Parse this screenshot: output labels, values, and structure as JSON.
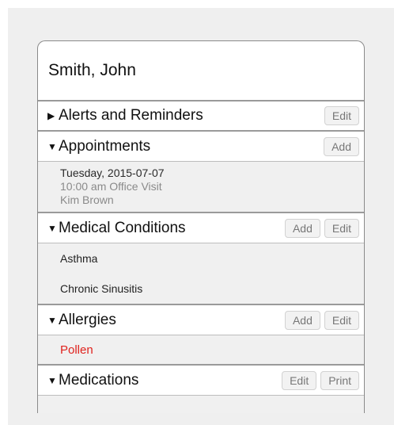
{
  "patient": {
    "name": "Smith, John"
  },
  "sections": {
    "alerts": {
      "arrow": "▶",
      "title": "Alerts and Reminders",
      "buttons": [
        "Edit"
      ]
    },
    "appointments": {
      "arrow": "▼",
      "title": "Appointments",
      "buttons": [
        "Add"
      ],
      "items": [
        {
          "date": "Tuesday, 2015-07-07",
          "time_type": "10:00 am Office Visit",
          "provider": "Kim Brown"
        }
      ]
    },
    "conditions": {
      "arrow": "▼",
      "title": "Medical Conditions",
      "buttons": [
        "Add",
        "Edit"
      ],
      "items": [
        "Asthma",
        "Chronic Sinusitis"
      ]
    },
    "allergies": {
      "arrow": "▼",
      "title": "Allergies",
      "buttons": [
        "Add",
        "Edit"
      ],
      "items": [
        "Pollen"
      ]
    },
    "medications": {
      "arrow": "▼",
      "title": "Medications",
      "buttons": [
        "Edit",
        "Print"
      ]
    }
  },
  "colors": {
    "allergy_text": "#e0231e",
    "section_body_bg": "#f0f0f0",
    "border": "#9a9a9a"
  }
}
